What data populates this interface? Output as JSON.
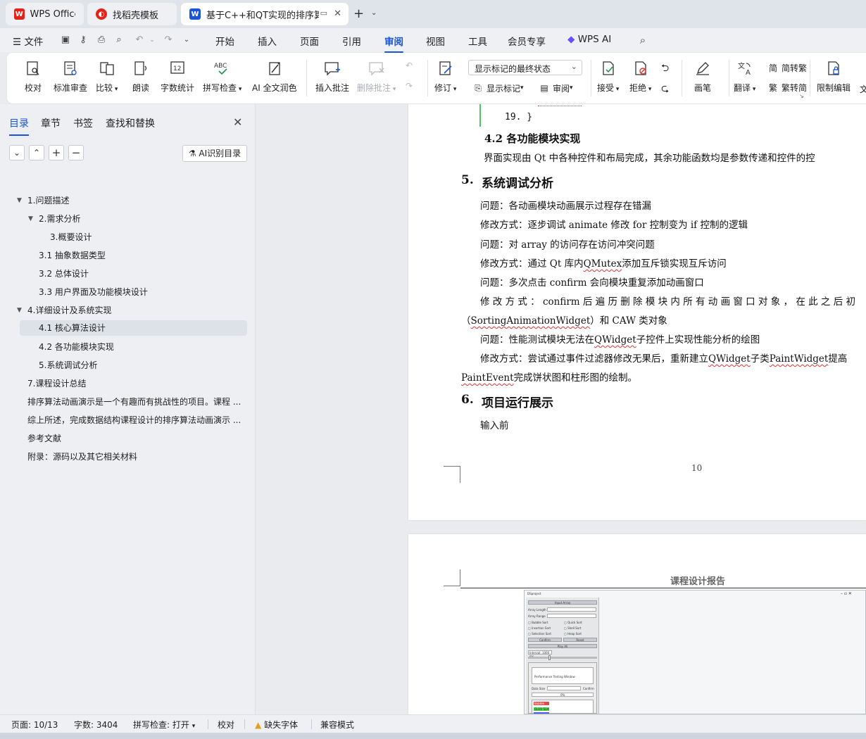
{
  "titlebar": {
    "tabs": [
      {
        "label": "WPS Office",
        "icon": "wps-logo-icon",
        "color": "#e2231a"
      },
      {
        "label": "找稻壳模板",
        "icon": "docer-logo-icon",
        "color": "#e2231a"
      },
      {
        "label": "基于C++和QT实现的排序算",
        "icon": "word-doc-icon",
        "color": "#1a54d6"
      }
    ]
  },
  "menubar": {
    "file": "文件",
    "items": [
      "开始",
      "插入",
      "页面",
      "引用",
      "审阅",
      "视图",
      "工具",
      "会员专享"
    ],
    "active": "审阅",
    "ai": "WPS AI"
  },
  "ribbon": {
    "proofread": "校对",
    "std_review": "标准审查",
    "compare": "比较",
    "read_aloud": "朗读",
    "word_count": "字数统计",
    "spell_check": "拼写检查",
    "ai_polish": "AI 全文润色",
    "insert_comment": "插入批注",
    "delete_comment": "删除批注",
    "revise": "修订",
    "markup_select": "显示标记的最终状态",
    "show_markup": "显示标记",
    "review": "审阅",
    "accept": "接受",
    "reject": "拒绝",
    "pen": "画笔",
    "translate": "翻译",
    "to_traditional": "简转繁",
    "to_simplified": "繁转简",
    "restrict_edit": "限制编辑",
    "more": "文"
  },
  "sidebar": {
    "tabs": [
      "目录",
      "章节",
      "书签",
      "查找和替换"
    ],
    "active_tab": "目录",
    "ai_toc": "AI识别目录",
    "toc": [
      "1.问题描述",
      "2.需求分析",
      "3.概要设计",
      "3.1 抽象数据类型",
      "3.2  总体设计",
      "3.3  用户界面及功能模块设计",
      "4.详细设计及系统实现",
      "4.1  核心算法设计",
      "4.2  各功能模块实现",
      "5.系统调试分析",
      "7.课程设计总结",
      "排序算法动画演示是一个有趣而有挑战性的项目。课程 ...",
      "综上所述，完成数据结构课程设计的排序算法动画演示 ...",
      "参考文献",
      "附录：源码以及其它相关材料"
    ]
  },
  "document": {
    "code_line": "19. }",
    "h_4_2": "4.2 各功能模块实现",
    "p_4_2": "界面实现由 Qt 中各种控件和布局完成，其余功能函数均是参数传递和控件的控",
    "h5_num": "5.",
    "h5_title": "系统调试分析",
    "lines": [
      [
        "问题：各动画模块动画展示过程存在错漏"
      ],
      [
        "修改方式：逐步调试 animate 修改 for 控制变为 if 控制的逻辑"
      ],
      [
        "问题：对 array 的访问存在访问冲突问题"
      ],
      [
        "修改方式：通过 Qt 库内",
        "QMutex",
        "添加互斥锁实现互斥访问"
      ],
      [
        "问题：多次点击 confirm 会向模块重复添加动画窗口"
      ],
      [
        "修 改 方 式 ： confirm 后 遍 历 删 除 模 块 内 所 有 动 画 窗 口 对 象 ， 在 此 之 后 初"
      ],
      [
        "（",
        "SortingAnimationWidget",
        "）和 CAW 类对象"
      ],
      [
        "问题：性能测试模块无法在",
        "QWidget",
        "子控件上实现性能分析的绘图"
      ],
      [
        "修改方式：尝试通过事件过滤器修改无果后，重新建立",
        "QWidget",
        "子类",
        "PaintWidget",
        "提高"
      ],
      [
        "PaintEvent",
        "完成饼状图和柱形图的绘制。"
      ]
    ],
    "h6_num": "6.",
    "h6_title": "项目运行展示",
    "p6": "输入前",
    "page_number": "10",
    "header2": "课程设计报告",
    "shot": {
      "title": "DSproject",
      "input_array": "Input Array",
      "array_length": "Array Length",
      "array_range": "Array Range",
      "bubble": "Bubble Sort",
      "quick": "Quick Sort",
      "insertion": "Insertion Sort",
      "shell": "Shell Sort",
      "selection": "Selection Sort",
      "heap": "Heap Sort",
      "confirm": "Confirm",
      "reset": "Reset",
      "play_all": "Play All",
      "interval": "Interval: 1000 ms",
      "perf": "Performance Testing Window",
      "data_size": "Data Size",
      "confirm2": "Confirm",
      "percent": "0%",
      "bubble2": "Bubble Sort",
      "quick2": "Quick Sort"
    }
  },
  "statusbar": {
    "page": "页面: 10/13",
    "words": "字数: 3404",
    "spell": "拼写检查: 打开",
    "proof": "校对",
    "missing_font": "缺失字体",
    "compat": "兼容模式"
  }
}
